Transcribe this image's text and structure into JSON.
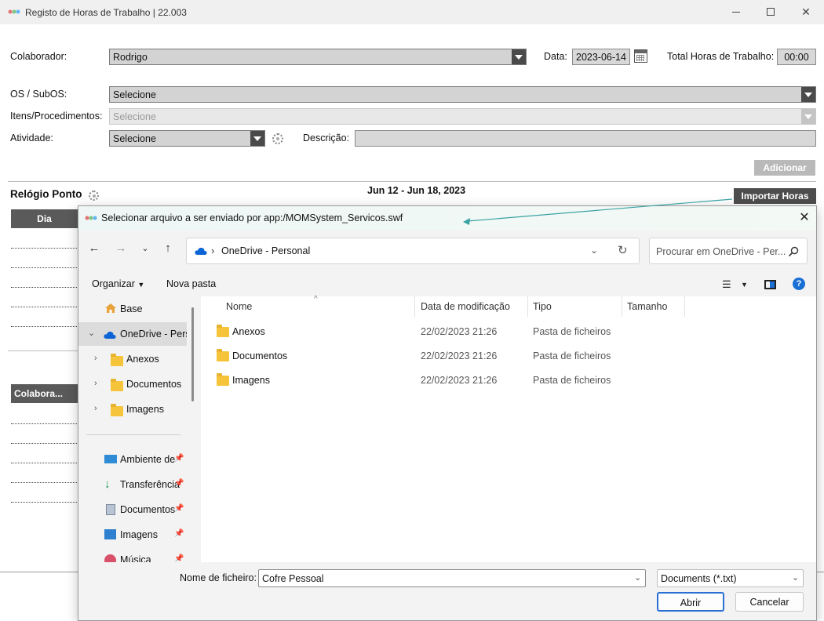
{
  "app": {
    "title": "Registo de Horas de Trabalho | 22.003",
    "colaborador_label": "Colaborador:",
    "colaborador_value": "Rodrigo",
    "data_label": "Data:",
    "data_value": "2023-06-14",
    "total_label": "Total Horas de Trabalho:",
    "total_value": "00:00",
    "os_label": "OS / SubOS:",
    "os_value": "Selecione",
    "itens_label": "Itens/Procedimentos:",
    "itens_value": "Selecione",
    "atividade_label": "Atividade:",
    "atividade_value": "Selecione",
    "descricao_label": "Descrição:",
    "descricao_value": "",
    "adicionar_label": "Adicionar",
    "relogio_label": "Relógio Ponto",
    "week_range": "Jun 12 - Jun 18, 2023",
    "importar_label": "Importar Horas",
    "col_dia": "Dia",
    "col_colaborador": "Colabora..."
  },
  "dialog": {
    "title": "Selecionar arquivo a ser enviado por app:/MOMSystem_Servicos.swf",
    "address": "OneDrive - Personal",
    "search_placeholder": "Procurar em OneDrive - Per...",
    "organize_label": "Organizar",
    "new_folder_label": "Nova pasta",
    "nav": {
      "base": "Base",
      "onedrive": "OneDrive - Personal",
      "folders": [
        "Anexos",
        "Documentos",
        "Imagens"
      ],
      "quick": [
        "Ambiente de",
        "Transferência",
        "Documentos",
        "Imagens",
        "Música"
      ]
    },
    "columns": {
      "name": "Nome",
      "date": "Data de modificação",
      "type": "Tipo",
      "size": "Tamanho"
    },
    "files": [
      {
        "name": "Anexos",
        "date": "22/02/2023 21:26",
        "type": "Pasta de ficheiros"
      },
      {
        "name": "Documentos",
        "date": "22/02/2023 21:26",
        "type": "Pasta de ficheiros"
      },
      {
        "name": "Imagens",
        "date": "22/02/2023 21:26",
        "type": "Pasta de ficheiros"
      }
    ],
    "filename_label": "Nome de ficheiro:",
    "filename_value": "Cofre Pessoal",
    "filetype_value": "Documents (*.txt)",
    "open_label": "Abrir",
    "cancel_label": "Cancelar"
  },
  "colors": {
    "accent": "#1a6fd6",
    "dark_header": "#4d4d4d",
    "connector": "#3aa3a3"
  }
}
